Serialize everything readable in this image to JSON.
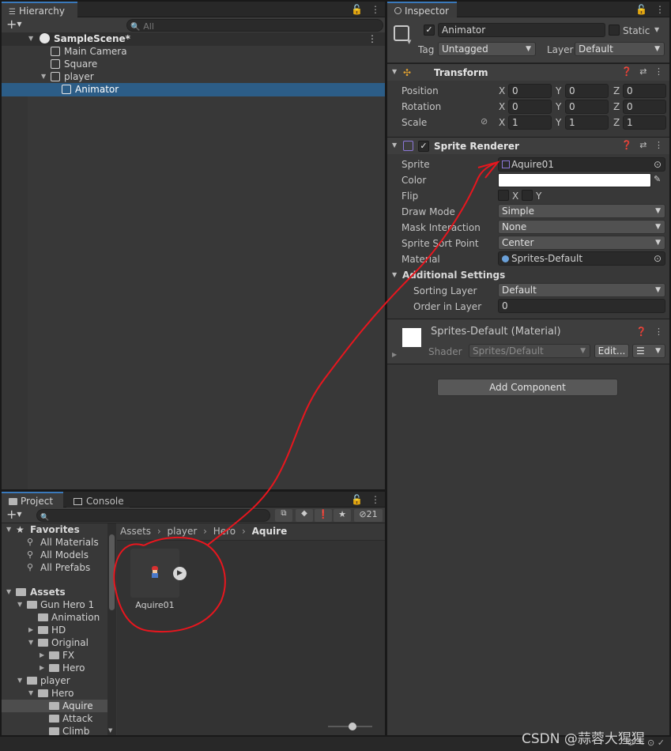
{
  "hierarchy": {
    "tab_label": "Hierarchy",
    "add_label": "+",
    "search_placeholder": "All",
    "scene_name": "SampleScene*",
    "items": [
      {
        "label": "Main Camera"
      },
      {
        "label": "Square"
      },
      {
        "label": "player"
      },
      {
        "label": "Animator"
      }
    ]
  },
  "inspector": {
    "tab_label": "Inspector",
    "object_name": "Animator",
    "static_label": "Static",
    "tag_label": "Tag",
    "tag_value": "Untagged",
    "layer_label": "Layer",
    "layer_value": "Default",
    "transform": {
      "title": "Transform",
      "position_label": "Position",
      "rotation_label": "Rotation",
      "scale_label": "Scale",
      "axis_x": "X",
      "axis_y": "Y",
      "axis_z": "Z",
      "position": {
        "x": "0",
        "y": "0",
        "z": "0"
      },
      "rotation": {
        "x": "0",
        "y": "0",
        "z": "0"
      },
      "scale": {
        "x": "1",
        "y": "1",
        "z": "1"
      }
    },
    "sprite_renderer": {
      "title": "Sprite Renderer",
      "sprite_label": "Sprite",
      "sprite_value": "Aquire01",
      "color_label": "Color",
      "color_value": "#ffffff",
      "flip_label": "Flip",
      "flip_x": "X",
      "flip_y": "Y",
      "draw_mode_label": "Draw Mode",
      "draw_mode_value": "Simple",
      "mask_label": "Mask Interaction",
      "mask_value": "None",
      "sort_point_label": "Sprite Sort Point",
      "sort_point_value": "Center",
      "material_label": "Material",
      "material_value": "Sprites-Default",
      "additional_label": "Additional Settings",
      "sorting_layer_label": "Sorting Layer",
      "sorting_layer_value": "Default",
      "order_label": "Order in Layer",
      "order_value": "0"
    },
    "material_block": {
      "title": "Sprites-Default (Material)",
      "shader_label": "Shader",
      "shader_value": "Sprites/Default",
      "edit_label": "Edit...",
      "list_icon": "☰"
    },
    "add_component_label": "Add Component"
  },
  "project": {
    "tab_project": "Project",
    "tab_console": "Console",
    "add_label": "+",
    "hidden_count": "21",
    "favorites_label": "Favorites",
    "favorites": [
      "All Materials",
      "All Models",
      "All Prefabs"
    ],
    "assets_label": "Assets",
    "tree": [
      {
        "label": "Gun Hero 1"
      },
      {
        "label": "Animation"
      },
      {
        "label": "HD"
      },
      {
        "label": "Original"
      },
      {
        "label": "FX"
      },
      {
        "label": "Hero"
      },
      {
        "label": "player"
      },
      {
        "label": "Hero"
      },
      {
        "label": "Aquire"
      },
      {
        "label": "Attack"
      },
      {
        "label": "Climb"
      }
    ],
    "breadcrumb": [
      "Assets",
      "player",
      "Hero",
      "Aquire"
    ],
    "asset_name": "Aquire01"
  },
  "watermark": "CSDN @蒜蓉大猩猩",
  "colors": {
    "selection": "#2c5d87",
    "annotation": "#e8161e",
    "accent": "#3a79bb"
  }
}
